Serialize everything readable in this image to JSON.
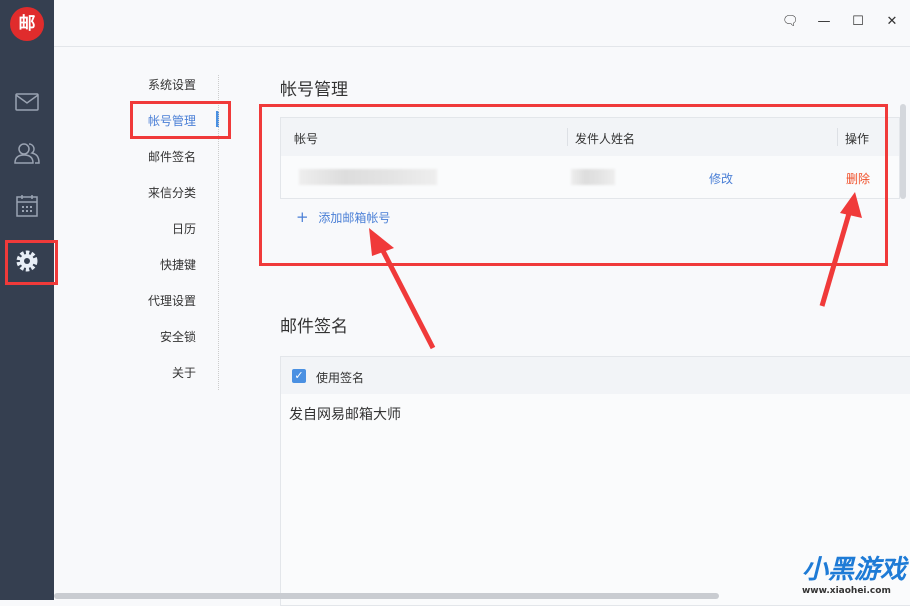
{
  "app": {
    "logo_text": "邮"
  },
  "sidebar": {
    "icons": [
      "mail-icon",
      "contacts-icon",
      "calendar-icon",
      "settings-icon"
    ]
  },
  "window": {
    "feedback": "feedback-icon",
    "minimize": "—",
    "maximize": "☐",
    "close": "✕"
  },
  "nav": {
    "items": [
      "系统设置",
      "帐号管理",
      "邮件签名",
      "来信分类",
      "日历",
      "快捷键",
      "代理设置",
      "安全锁",
      "关于"
    ],
    "active": 1
  },
  "accounts": {
    "title": "帐号管理",
    "columns": [
      "帐号",
      "发件人姓名",
      "操作"
    ],
    "rows": [
      {
        "edit": "修改",
        "delete": "删除"
      }
    ],
    "add_label": "添加邮箱帐号",
    "add_icon": "+"
  },
  "signature": {
    "title": "邮件签名",
    "use_label": "使用签名",
    "checked": true,
    "text": "发自网易邮箱大师"
  },
  "watermark": {
    "text": "小黑游戏",
    "url": "www.xiaohei.com"
  },
  "colors": {
    "accent": "#4a7fd6",
    "danger": "#f0502a",
    "highlight": "#f03a3a"
  }
}
